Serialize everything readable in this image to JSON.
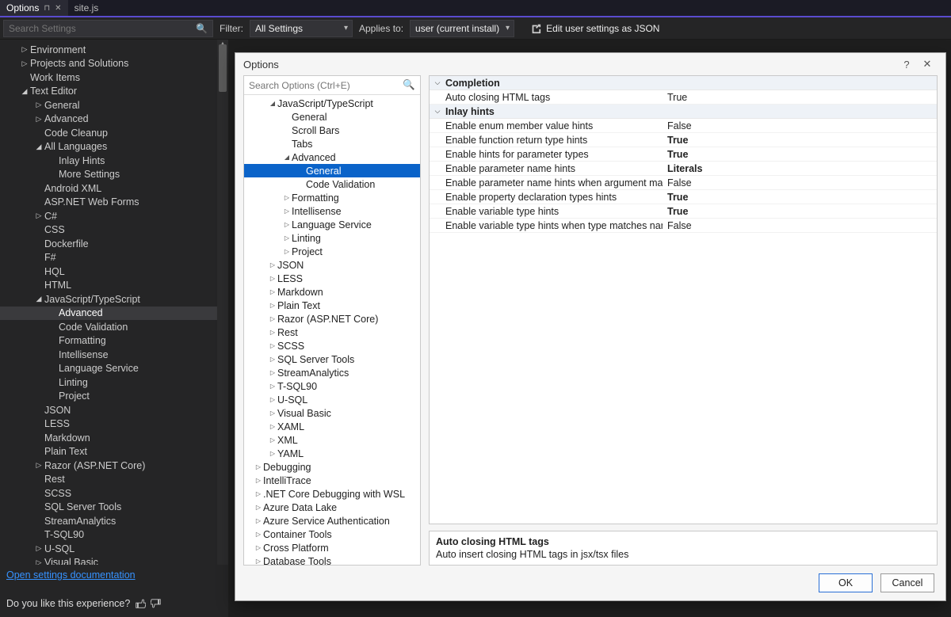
{
  "tabs": [
    {
      "label": "Options",
      "active": true,
      "pinned": true,
      "closable": true
    },
    {
      "label": "site.js",
      "active": false
    }
  ],
  "filterbar": {
    "search_placeholder": "Search Settings",
    "filter_label": "Filter:",
    "filter_value": "All Settings",
    "applies_label": "Applies to:",
    "applies_value": "user (current install)",
    "edit_json_label": "Edit user settings as JSON"
  },
  "sidebar_tree": [
    {
      "d": 1,
      "exp": "▷",
      "label": "Environment"
    },
    {
      "d": 1,
      "exp": "▷",
      "label": "Projects and Solutions"
    },
    {
      "d": 1,
      "exp": "",
      "label": "Work Items"
    },
    {
      "d": 1,
      "exp": "◢",
      "label": "Text Editor"
    },
    {
      "d": 2,
      "exp": "▷",
      "label": "General"
    },
    {
      "d": 2,
      "exp": "▷",
      "label": "Advanced"
    },
    {
      "d": 2,
      "exp": "",
      "label": "Code Cleanup"
    },
    {
      "d": 2,
      "exp": "◢",
      "label": "All Languages"
    },
    {
      "d": 3,
      "exp": "",
      "label": "Inlay Hints"
    },
    {
      "d": 3,
      "exp": "",
      "label": "More Settings"
    },
    {
      "d": 2,
      "exp": "",
      "label": "Android XML"
    },
    {
      "d": 2,
      "exp": "",
      "label": "ASP.NET Web Forms"
    },
    {
      "d": 2,
      "exp": "▷",
      "label": "C#"
    },
    {
      "d": 2,
      "exp": "",
      "label": "CSS"
    },
    {
      "d": 2,
      "exp": "",
      "label": "Dockerfile"
    },
    {
      "d": 2,
      "exp": "",
      "label": "F#"
    },
    {
      "d": 2,
      "exp": "",
      "label": "HQL"
    },
    {
      "d": 2,
      "exp": "",
      "label": "HTML"
    },
    {
      "d": 2,
      "exp": "◢",
      "label": "JavaScript/TypeScript"
    },
    {
      "d": 3,
      "exp": "",
      "label": "Advanced",
      "sel": true
    },
    {
      "d": 3,
      "exp": "",
      "label": "Code Validation"
    },
    {
      "d": 3,
      "exp": "",
      "label": "Formatting"
    },
    {
      "d": 3,
      "exp": "",
      "label": "Intellisense"
    },
    {
      "d": 3,
      "exp": "",
      "label": "Language Service"
    },
    {
      "d": 3,
      "exp": "",
      "label": "Linting"
    },
    {
      "d": 3,
      "exp": "",
      "label": "Project"
    },
    {
      "d": 2,
      "exp": "",
      "label": "JSON"
    },
    {
      "d": 2,
      "exp": "",
      "label": "LESS"
    },
    {
      "d": 2,
      "exp": "",
      "label": "Markdown"
    },
    {
      "d": 2,
      "exp": "",
      "label": "Plain Text"
    },
    {
      "d": 2,
      "exp": "▷",
      "label": "Razor (ASP.NET Core)"
    },
    {
      "d": 2,
      "exp": "",
      "label": "Rest"
    },
    {
      "d": 2,
      "exp": "",
      "label": "SCSS"
    },
    {
      "d": 2,
      "exp": "",
      "label": "SQL Server Tools"
    },
    {
      "d": 2,
      "exp": "",
      "label": "StreamAnalytics"
    },
    {
      "d": 2,
      "exp": "",
      "label": "T-SQL90"
    },
    {
      "d": 2,
      "exp": "▷",
      "label": "U-SQL"
    },
    {
      "d": 2,
      "exp": "▷",
      "label": "Visual Basic"
    }
  ],
  "sidebar_footer": {
    "doc_link": "Open settings documentation",
    "feedback_label": "Do you like this experience?"
  },
  "dialog": {
    "title": "Options",
    "help_icon": "?",
    "search_placeholder": "Search Options (Ctrl+E)",
    "tree": [
      {
        "d": 1,
        "exp": "◢",
        "label": "JavaScript/TypeScript"
      },
      {
        "d": 2,
        "exp": "",
        "label": "General"
      },
      {
        "d": 2,
        "exp": "",
        "label": "Scroll Bars"
      },
      {
        "d": 2,
        "exp": "",
        "label": "Tabs"
      },
      {
        "d": 2,
        "exp": "◢",
        "label": "Advanced"
      },
      {
        "d": 3,
        "exp": "",
        "label": "General",
        "sel": true
      },
      {
        "d": 3,
        "exp": "",
        "label": "Code Validation"
      },
      {
        "d": 2,
        "exp": "▷",
        "label": "Formatting"
      },
      {
        "d": 2,
        "exp": "▷",
        "label": "Intellisense"
      },
      {
        "d": 2,
        "exp": "▷",
        "label": "Language Service"
      },
      {
        "d": 2,
        "exp": "▷",
        "label": "Linting"
      },
      {
        "d": 2,
        "exp": "▷",
        "label": "Project"
      },
      {
        "d": 1,
        "exp": "▷",
        "label": "JSON"
      },
      {
        "d": 1,
        "exp": "▷",
        "label": "LESS"
      },
      {
        "d": 1,
        "exp": "▷",
        "label": "Markdown"
      },
      {
        "d": 1,
        "exp": "▷",
        "label": "Plain Text"
      },
      {
        "d": 1,
        "exp": "▷",
        "label": "Razor (ASP.NET Core)"
      },
      {
        "d": 1,
        "exp": "▷",
        "label": "Rest"
      },
      {
        "d": 1,
        "exp": "▷",
        "label": "SCSS"
      },
      {
        "d": 1,
        "exp": "▷",
        "label": "SQL Server Tools"
      },
      {
        "d": 1,
        "exp": "▷",
        "label": "StreamAnalytics"
      },
      {
        "d": 1,
        "exp": "▷",
        "label": "T-SQL90"
      },
      {
        "d": 1,
        "exp": "▷",
        "label": "U-SQL"
      },
      {
        "d": 1,
        "exp": "▷",
        "label": "Visual Basic"
      },
      {
        "d": 1,
        "exp": "▷",
        "label": "XAML"
      },
      {
        "d": 1,
        "exp": "▷",
        "label": "XML"
      },
      {
        "d": 1,
        "exp": "▷",
        "label": "YAML"
      },
      {
        "d": 0,
        "exp": "▷",
        "label": "Debugging"
      },
      {
        "d": 0,
        "exp": "▷",
        "label": "IntelliTrace"
      },
      {
        "d": 0,
        "exp": "▷",
        "label": ".NET Core Debugging with WSL"
      },
      {
        "d": 0,
        "exp": "▷",
        "label": "Azure Data Lake"
      },
      {
        "d": 0,
        "exp": "▷",
        "label": "Azure Service Authentication"
      },
      {
        "d": 0,
        "exp": "▷",
        "label": "Container Tools"
      },
      {
        "d": 0,
        "exp": "▷",
        "label": "Cross Platform"
      },
      {
        "d": 0,
        "exp": "▷",
        "label": "Database Tools"
      }
    ],
    "groups": [
      {
        "name": "Completion",
        "rows": [
          {
            "name": "Auto closing HTML tags",
            "value": "True",
            "bold": false
          }
        ]
      },
      {
        "name": "Inlay hints",
        "rows": [
          {
            "name": "Enable enum member value hints",
            "value": "False",
            "bold": false
          },
          {
            "name": "Enable function return type hints",
            "value": "True",
            "bold": true
          },
          {
            "name": "Enable hints for parameter types",
            "value": "True",
            "bold": true
          },
          {
            "name": "Enable parameter name hints",
            "value": "Literals",
            "bold": true
          },
          {
            "name": "Enable parameter name hints when argument matches nam",
            "value": "False",
            "bold": false
          },
          {
            "name": "Enable property declaration types hints",
            "value": "True",
            "bold": true
          },
          {
            "name": "Enable variable type hints",
            "value": "True",
            "bold": true
          },
          {
            "name": "Enable variable type hints when type matches name",
            "value": "False",
            "bold": false
          }
        ]
      }
    ],
    "description": {
      "title": "Auto closing HTML tags",
      "body": "Auto insert closing HTML tags in jsx/tsx files"
    },
    "buttons": {
      "ok": "OK",
      "cancel": "Cancel"
    }
  }
}
